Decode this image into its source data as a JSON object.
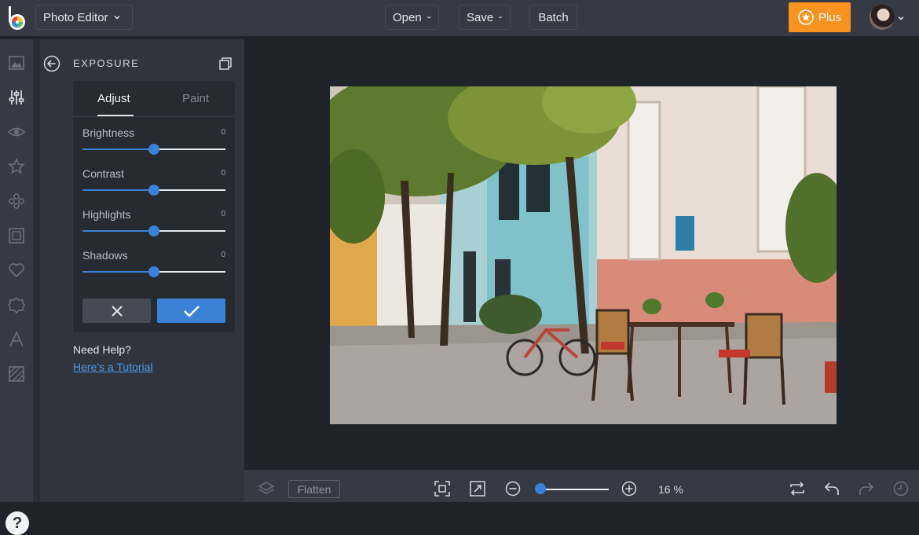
{
  "topbar": {
    "app_menu_label": "Photo Editor",
    "open_label": "Open",
    "save_label": "Save",
    "batch_label": "Batch",
    "plus_label": "Plus"
  },
  "rail": {
    "icons": [
      "image-icon",
      "sliders-icon",
      "eye-icon",
      "star-icon",
      "effects-icon",
      "frame-icon",
      "heart-icon",
      "shape-icon",
      "text-icon",
      "texture-icon"
    ],
    "help_label": "?"
  },
  "panel": {
    "title": "EXPOSURE",
    "tabs": [
      {
        "label": "Adjust"
      },
      {
        "label": "Paint"
      }
    ],
    "sliders": [
      {
        "label": "Brightness",
        "value": "0",
        "level": 0.5
      },
      {
        "label": "Contrast",
        "value": "0",
        "level": 0.5
      },
      {
        "label": "Highlights",
        "value": "0",
        "level": 0.5
      },
      {
        "label": "Shadows",
        "value": "0",
        "level": 0.5
      }
    ],
    "need_help": "Need Help?",
    "tutorial_link": "Here's a Tutorial"
  },
  "bottombar": {
    "flatten_label": "Flatten",
    "zoom_value": "16 %",
    "zoom_level": 0.05
  },
  "colors": {
    "accent": "#3b82d6",
    "plus": "#f7931e",
    "topbar": "#353a44"
  }
}
